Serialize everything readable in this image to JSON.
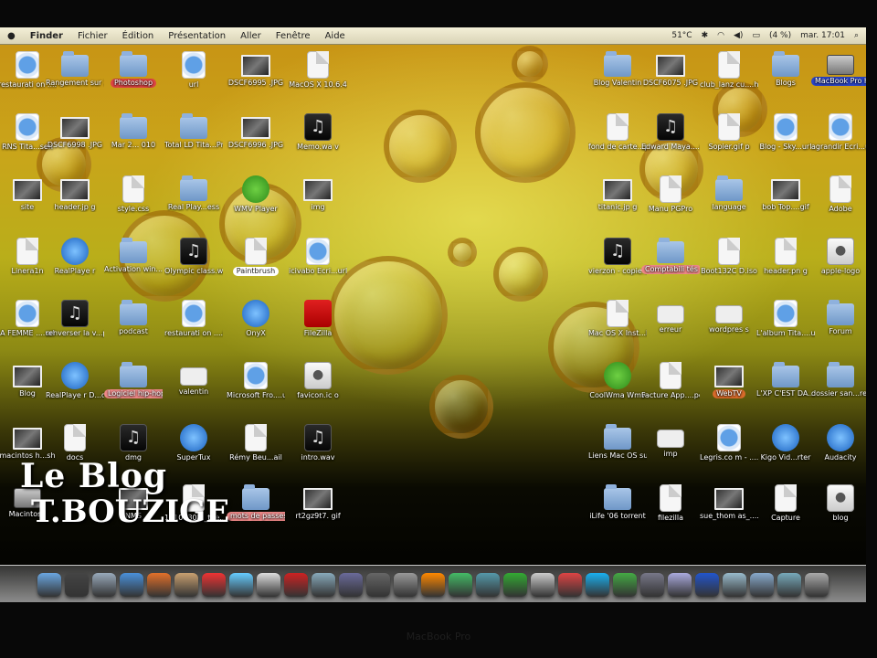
{
  "menubar": {
    "apple": "",
    "items": [
      "Finder",
      "Fichier",
      "Édition",
      "Présentation",
      "Aller",
      "Fenêtre",
      "Aide"
    ],
    "temp": "51°C",
    "battery": "(4 %)",
    "clock": "mar. 17:01"
  },
  "desktop_icons": [
    {
      "label": "restaurati on ....url",
      "type": "webloc"
    },
    {
      "label": "Rangement sur 2010",
      "type": "folder"
    },
    {
      "label": "Photoshop",
      "type": "folder",
      "tag": "red"
    },
    {
      "label": "url",
      "type": "webloc"
    },
    {
      "label": "DSCF6995 .JPG",
      "type": "photo"
    },
    {
      "label": "MacOS X 10.6.4",
      "type": "doc"
    },
    {
      "label": "RNS Tita...sen",
      "type": "webloc"
    },
    {
      "label": "DSCF6998 .JPG",
      "type": "photo"
    },
    {
      "label": "Mar 2... 010",
      "type": "folder"
    },
    {
      "label": "Total LD Tita...Pro",
      "type": "folder"
    },
    {
      "label": "DSCF6996 .JPG",
      "type": "photo"
    },
    {
      "label": "Memo.wa v",
      "type": "audio"
    },
    {
      "label": "site",
      "type": "photo"
    },
    {
      "label": "header.jp g",
      "type": "photo"
    },
    {
      "label": "style.css",
      "type": "doc"
    },
    {
      "label": "Real Play...ess",
      "type": "folder"
    },
    {
      "label": "WMV Player",
      "type": "green"
    },
    {
      "label": "img",
      "type": "photo"
    },
    {
      "label": "Linera1n",
      "type": "doc"
    },
    {
      "label": "RealPlaye r",
      "type": "blue"
    },
    {
      "label": "Activation win... 7",
      "type": "folder"
    },
    {
      "label": "Olympic class.wav",
      "type": "audio"
    },
    {
      "label": "Paintbrush",
      "type": "doc",
      "tag": "white"
    },
    {
      "label": "icivabo Ecri...url",
      "type": "webloc"
    },
    {
      "label": "A FEMME ....url",
      "type": "webloc"
    },
    {
      "label": "renverser la v...p3",
      "type": "audio"
    },
    {
      "label": "podcast",
      "type": "folder"
    },
    {
      "label": "restaurati on ....url",
      "type": "webloc"
    },
    {
      "label": "OnyX",
      "type": "blue"
    },
    {
      "label": "FileZilla",
      "type": "red"
    },
    {
      "label": "Blog",
      "type": "photo"
    },
    {
      "label": "RealPlaye r D...der",
      "type": "blue"
    },
    {
      "label": "Logiciel hip-hop",
      "type": "folder",
      "tag": "pink"
    },
    {
      "label": "valentin",
      "type": "white"
    },
    {
      "label": "Microsoft Fro....url",
      "type": "webloc"
    },
    {
      "label": "favicon.ic o",
      "type": "apple"
    },
    {
      "label": "macintos h...sh",
      "type": "photo"
    },
    {
      "label": "docs",
      "type": "doc"
    },
    {
      "label": "dmg",
      "type": "audio"
    },
    {
      "label": "SuperTux",
      "type": "blue"
    },
    {
      "label": "Rémy Beu...ail",
      "type": "doc"
    },
    {
      "label": "intro.wav",
      "type": "audio"
    },
    {
      "label": "Macintosh",
      "type": "drive"
    },
    {
      "label": "NMS",
      "type": "photo"
    },
    {
      "label": "15100308 _the....sql",
      "type": "doc"
    },
    {
      "label": "mots de passes",
      "type": "folder",
      "tag": "pink"
    },
    {
      "label": "rt2gz9t7. gif",
      "type": "photo"
    },
    {
      "label": "Blog Valentin",
      "type": "folder"
    },
    {
      "label": "DSCF6075 .JPG",
      "type": "photo"
    },
    {
      "label": "club_lanz cu....html",
      "type": "doc"
    },
    {
      "label": "Blogs",
      "type": "folder"
    },
    {
      "label": "MacBook Pro HD",
      "type": "drive",
      "tag": "blue"
    },
    {
      "label": "fond de carte...pdf",
      "type": "doc"
    },
    {
      "label": "Edward Maya....wav",
      "type": "audio"
    },
    {
      "label": "Sopier.gif p",
      "type": "doc"
    },
    {
      "label": "Blog - Sky...url",
      "type": "webloc"
    },
    {
      "label": "agrandir Ecri...url",
      "type": "webloc"
    },
    {
      "label": "titanic.jp g",
      "type": "photo"
    },
    {
      "label": "Manu PGPro",
      "type": "doc"
    },
    {
      "label": "language",
      "type": "folder"
    },
    {
      "label": "bob Top....gif",
      "type": "photo"
    },
    {
      "label": "Adobe",
      "type": "doc"
    },
    {
      "label": "vierzon - copie.wav",
      "type": "audio"
    },
    {
      "label": "Comptabili tés",
      "type": "folder",
      "tag": "pink"
    },
    {
      "label": "Boot132C D.iso",
      "type": "doc"
    },
    {
      "label": "header.pn g",
      "type": "doc"
    },
    {
      "label": "apple-logo",
      "type": "apple"
    },
    {
      "label": "Mac OS X Inst...ISO",
      "type": "doc"
    },
    {
      "label": "erreur",
      "type": "white"
    },
    {
      "label": "wordpres s",
      "type": "white"
    },
    {
      "label": "L'album Tita....url",
      "type": "webloc"
    },
    {
      "label": "Forum",
      "type": "folder"
    },
    {
      "label": "CoolWma Wmv",
      "type": "green"
    },
    {
      "label": "Facture App....pdf",
      "type": "doc"
    },
    {
      "label": "WebTV",
      "type": "photo",
      "tag": "orange"
    },
    {
      "label": "L'XP C'EST DA...CHE",
      "type": "folder"
    },
    {
      "label": "dossier san...re 2",
      "type": "folder"
    },
    {
      "label": "Liens Mac OS sur PC",
      "type": "folder"
    },
    {
      "label": "imp",
      "type": "white"
    },
    {
      "label": "Legris.co m - ....url",
      "type": "webloc"
    },
    {
      "label": "Kigo Vid...rter",
      "type": "blue"
    },
    {
      "label": "Audacity",
      "type": "blue"
    },
    {
      "label": "iLife '06 torrent",
      "type": "folder"
    },
    {
      "label": "filezilla",
      "type": "doc"
    },
    {
      "label": "sue_thom as_....jpg",
      "type": "photo"
    },
    {
      "label": "Capture",
      "type": "doc"
    },
    {
      "label": "blog",
      "type": "apple"
    }
  ],
  "watermark": {
    "line1": "Le Blog",
    "line2": "T.BOUZIGE"
  },
  "dock_items": [
    "finder",
    "dashboard",
    "mail",
    "safari",
    "firefox",
    "address-book",
    "ical",
    "itunes",
    "preview",
    "photo-booth",
    "iphoto",
    "imovie",
    "time-machine",
    "system-preferences",
    "vlc",
    "ichat",
    "xcode",
    "activity-monitor",
    "boot-camp",
    "transmission",
    "skype",
    "facetime",
    "photo",
    "spotlight",
    "word",
    "downloads",
    "documents",
    "applications",
    "trash"
  ],
  "hardware_label": "MacBook Pro",
  "colors": {
    "wallpaper_top": "#c89214",
    "wallpaper_mid": "#b9ae1a",
    "wallpaper_bottom": "#000000",
    "menubar": "#eae5cb"
  }
}
